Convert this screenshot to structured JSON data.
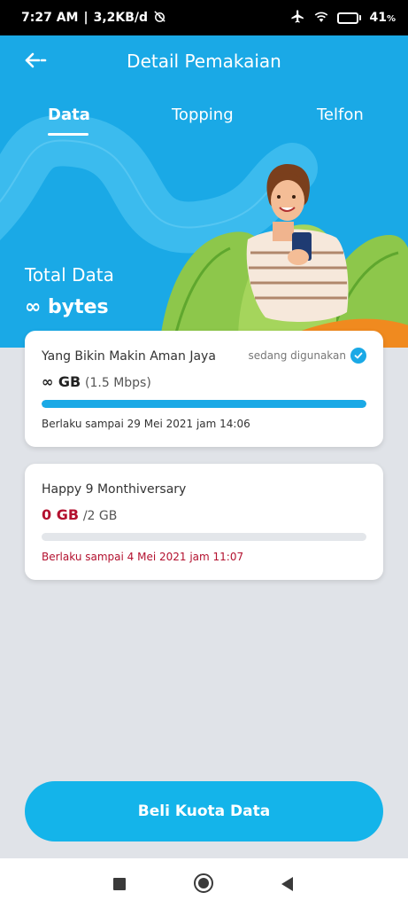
{
  "status_bar": {
    "time": "7:27 AM",
    "speed": "3,2KB/d",
    "battery": "41",
    "battery_unit": "%",
    "battery_level": 0.41
  },
  "header": {
    "title": "Detail Pemakaian"
  },
  "tabs": [
    {
      "label": "Data",
      "active": true
    },
    {
      "label": "Topping",
      "active": false
    },
    {
      "label": "Telfon",
      "active": false
    }
  ],
  "summary": {
    "label": "Total Data",
    "value": "∞ bytes"
  },
  "packages": [
    {
      "name": "Yang Bikin Makin Aman Jaya",
      "status": "sedang digunakan",
      "quota_main": "∞ GB",
      "quota_sub": "(1.5 Mbps)",
      "progress": 1.0,
      "validity": "Berlaku sampai 29 Mei 2021 jam 14:06"
    },
    {
      "name": "Happy 9 Monthiversary",
      "quota_main": "0 GB",
      "quota_sub": "/2 GB",
      "progress": 0.0,
      "validity": "Berlaku sampai 4 Mei 2021 jam 11:07"
    }
  ],
  "action": {
    "buy_label": "Beli Kuota Data"
  },
  "colors": {
    "primary": "#1aa9e6",
    "button": "#14b4ea",
    "expiry_red": "#b3112f",
    "background": "#e0e3e8"
  }
}
